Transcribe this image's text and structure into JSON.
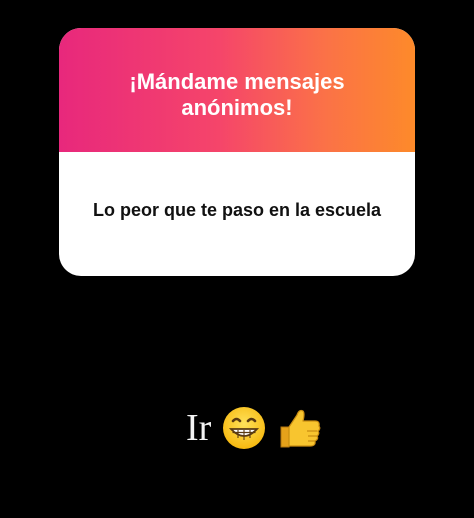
{
  "question_card": {
    "title": "¡Mándame mensajes anónimos!",
    "question": "Lo peor que te paso en la escuela"
  },
  "caption": {
    "text": "Ir",
    "emojis": [
      "grinning-face-icon",
      "thumbs-up-icon"
    ]
  },
  "colors": {
    "background": "#000000",
    "gradient_start": "#e8287c",
    "gradient_end": "#fd8a2a",
    "card_body": "#ffffff"
  }
}
